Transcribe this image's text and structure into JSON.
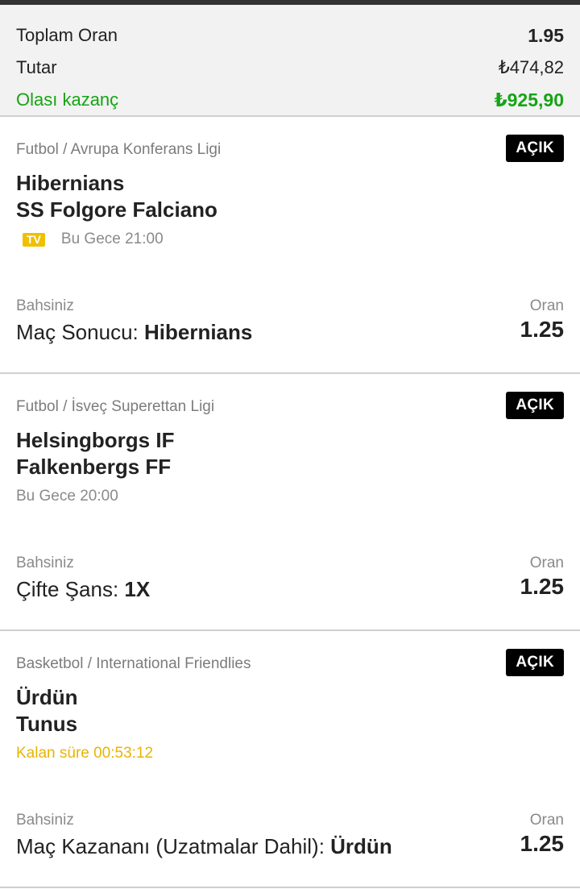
{
  "summary": {
    "total_odds_label": "Toplam Oran",
    "total_odds_value": "1.95",
    "stake_label": "Tutar",
    "stake_value": "₺474,82",
    "win_label": "Olası kazanç",
    "win_value": "₺925,90"
  },
  "colors": {
    "win": "#15a415",
    "live": "#e8b400",
    "badge": "#000000",
    "tv": "#f0c000"
  },
  "bets": [
    {
      "league": "Futbol / Avrupa Konferans Ligi",
      "status": "AÇIK",
      "home": "Hibernians",
      "away": "SS Folgore Falciano",
      "tv": "TV",
      "time": "Bu Gece 21:00",
      "bet_label": "Bahsiniz",
      "market": "Maç Sonucu:",
      "selection": "Hibernians",
      "odds_label": "Oran",
      "odds": "1.25"
    },
    {
      "league": "Futbol / İsveç Superettan Ligi",
      "status": "AÇIK",
      "home": "Helsingborgs IF",
      "away": "Falkenbergs FF",
      "time": "Bu Gece 20:00",
      "bet_label": "Bahsiniz",
      "market": "Çifte Şans:",
      "selection": "1X",
      "odds_label": "Oran",
      "odds": "1.25"
    },
    {
      "league": "Basketbol / International Friendlies",
      "status": "AÇIK",
      "home": "Ürdün",
      "away": "Tunus",
      "time": "Kalan süre 00:53:12",
      "bet_label": "Bahsiniz",
      "market": "Maç Kazananı (Uzatmalar Dahil):",
      "selection": "Ürdün",
      "odds_label": "Oran",
      "odds": "1.25"
    }
  ]
}
